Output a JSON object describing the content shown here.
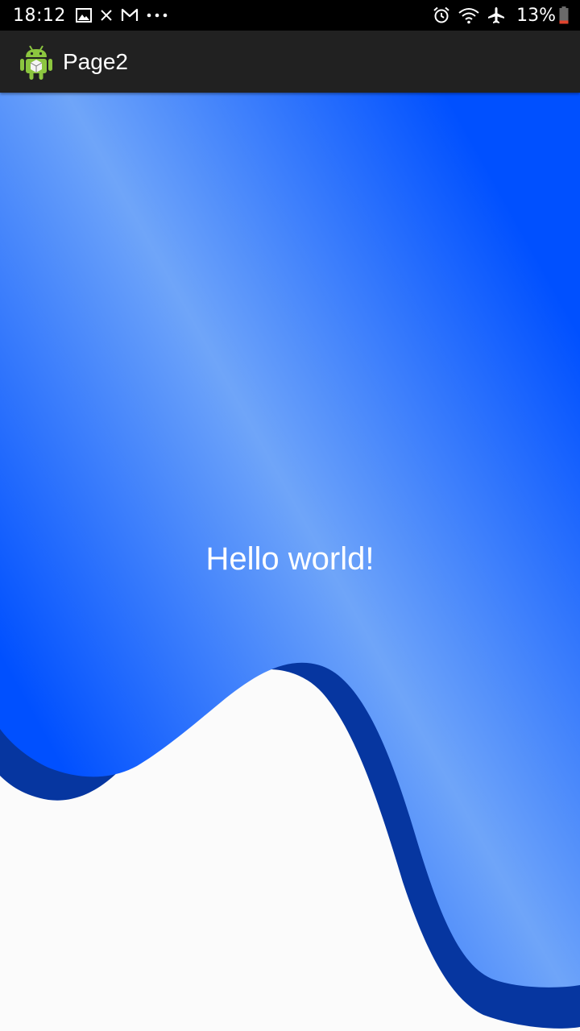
{
  "status_bar": {
    "time": "18:12",
    "battery_percent": "13%",
    "notification_icons": [
      "image-icon",
      "close-icon",
      "gmail-icon",
      "more-dots-icon"
    ],
    "system_icons": [
      "alarm-icon",
      "wifi-icon",
      "airplane-mode-icon",
      "battery-icon"
    ]
  },
  "action_bar": {
    "title": "Page2",
    "app_icon": "android-robot-icon"
  },
  "main": {
    "greeting": "Hello world!"
  },
  "colors": {
    "status_bar_bg": "#000000",
    "action_bar_bg": "#212121",
    "gradient_dark_blue": "#0050ff",
    "gradient_light_blue": "#6fa5f9",
    "wave_shadow_blue": "#0636a0",
    "background": "#fbfbfb"
  }
}
